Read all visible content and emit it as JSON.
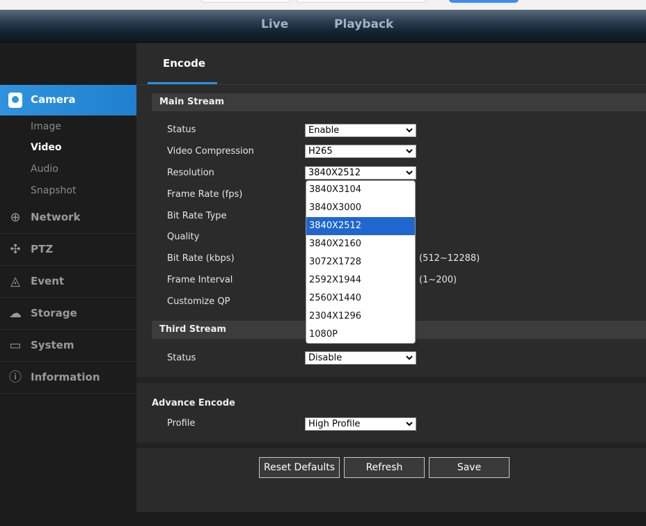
{
  "header": {
    "nav": [
      "Live",
      "Playback"
    ]
  },
  "sidebar": {
    "camera_label": "Camera",
    "camera_sub": [
      "Image",
      "Video",
      "Audio",
      "Snapshot"
    ],
    "menus": [
      "Network",
      "PTZ",
      "Event",
      "Storage",
      "System",
      "Information"
    ],
    "active_sub": "Video"
  },
  "tab": {
    "label": "Encode"
  },
  "main_stream": {
    "title": "Main Stream",
    "labels": [
      "Status",
      "Video Compression",
      "Resolution",
      "Frame Rate (fps)",
      "Bit Rate Type",
      "Quality",
      "Bit Rate (kbps)",
      "Frame Interval",
      "Customize QP"
    ],
    "status": "Enable",
    "compression": "H265",
    "resolution": "3840X2512",
    "bitrate_hint": "(512~12288)",
    "interval_hint": "(1~200)"
  },
  "resolution_options": [
    "3840X3104",
    "3840X3000",
    "3840X2512",
    "3840X2160",
    "3072X1728",
    "2592X1944",
    "2560X1440",
    "2304X1296",
    "1080P"
  ],
  "selected_resolution": "3840X2512",
  "third_stream": {
    "title": "Third Stream",
    "status_label": "Status",
    "status": "Disable"
  },
  "advance": {
    "title": "Advance Encode",
    "profile_label": "Profile",
    "profile": "High Profile"
  },
  "buttons": {
    "reset": "Reset Defaults",
    "refresh": "Refresh",
    "save": "Save"
  },
  "colors": {
    "accent": "#2b8fe0",
    "selected": "#1f66cf"
  }
}
